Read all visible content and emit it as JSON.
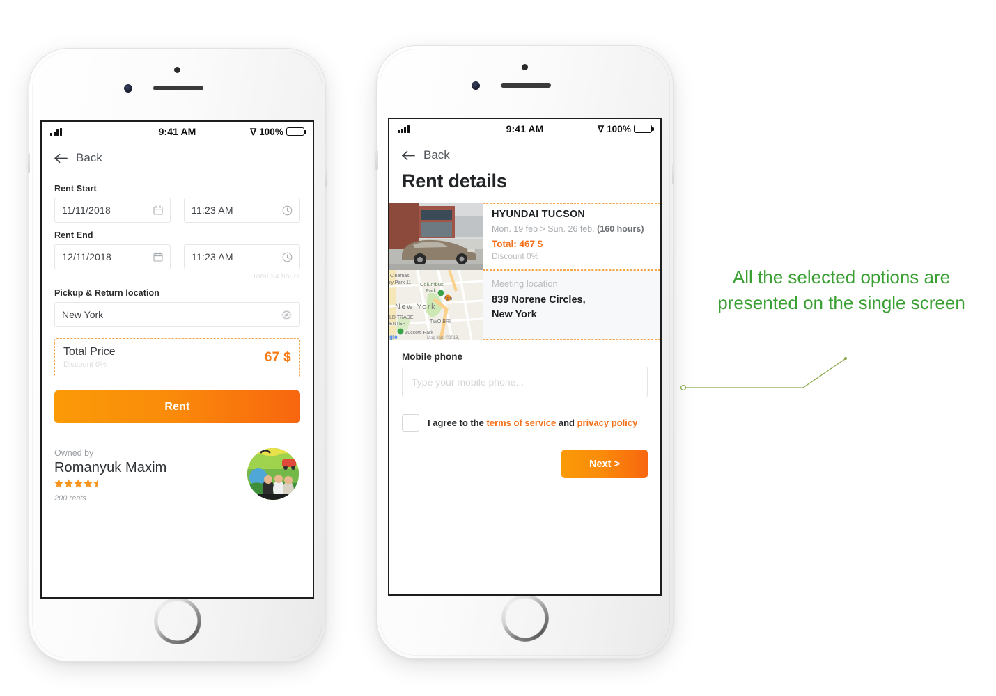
{
  "status_bar": {
    "time": "9:41 AM",
    "battery_percent": "100%",
    "signal_icon": "signal-bars-icon",
    "bluetooth_icon": "bluetooth-icon",
    "battery_icon": "battery-full-icon"
  },
  "screen1": {
    "back_label": "Back",
    "back_icon": "arrow-left-icon",
    "rent_start": {
      "label": "Rent Start",
      "date_value": "11/11/2018",
      "date_icon": "calendar-icon",
      "time_value": "11:23 AM",
      "time_icon": "clock-icon"
    },
    "rent_end": {
      "label": "Rent End",
      "date_value": "12/11/2018",
      "date_icon": "calendar-icon",
      "time_value": "11:23 AM",
      "time_icon": "clock-icon"
    },
    "duration_hint": "Total 24 hours",
    "location": {
      "label": "Pickup & Return location",
      "value": "New York",
      "icon": "compass-locate-icon"
    },
    "total_price": {
      "title": "Total Price",
      "discount": "Discount 0%",
      "amount": "67 $"
    },
    "rent_button": "Rent",
    "owner": {
      "owned_by_label": "Owned by",
      "name": "Romanyuk Maxim",
      "rating": 4.5,
      "rents": "200 rents",
      "avatar_icon": "user-avatar-photo"
    }
  },
  "screen2": {
    "back_label": "Back",
    "back_icon": "arrow-left-icon",
    "title": "Rent details",
    "car": {
      "name": "HYUNDAI TUCSON",
      "dates_prefix": "Mon. 19 feb > Sun. 26 feb. ",
      "dates_hours": "(160 hours)",
      "total": "Total: 467 $",
      "discount": "Discount 0%",
      "thumb_icon": "car-photo"
    },
    "meeting": {
      "label": "Meeting location",
      "address_line1": "839 Norene Circles,",
      "address_line2": "New York",
      "map_icon": "map-thumbnail",
      "map_labels": {
        "cinemas": "Cinemas",
        "park11": "ry Park 11",
        "columbus": "Columbus",
        "park": "Park",
        "city": "New York",
        "trade": "LD TRADE",
        "center": "ENTER",
        "two_bridges": "TWO BRI",
        "zuccotti": "Zuccotti Park",
        "attribution": "Map data ©2018,",
        "google": "gle"
      }
    },
    "mobile": {
      "label": "Mobile phone",
      "placeholder": "Type your mobile phone..."
    },
    "agreement": {
      "prefix": "I agree to the ",
      "terms_link": "terms of service",
      "middle": " and ",
      "privacy_link": "privacy policy"
    },
    "next_button": "Next >"
  },
  "annotation": {
    "text": "All the selected options are presented on the single screen",
    "color": "#3aa033"
  },
  "colors": {
    "accent_orange": "#f4711c",
    "gradient_start": "#fb9a07",
    "gradient_end": "#f8660f",
    "dashed_border": "#f5a54a",
    "annotation_green": "#3aa033"
  }
}
